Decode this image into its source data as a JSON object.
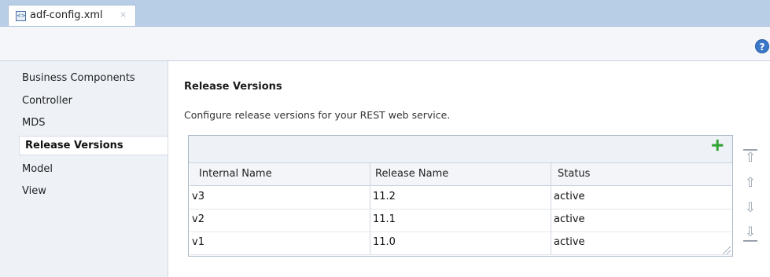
{
  "editor_tab": {
    "label": "adf-config.xml",
    "icon": "xml-file-icon",
    "close": "×"
  },
  "toolbar": {
    "help_icon": "help-icon",
    "help_glyph": "?"
  },
  "sidebar": {
    "items": [
      {
        "label": "Business Components"
      },
      {
        "label": "Controller"
      },
      {
        "label": "MDS"
      },
      {
        "label": "Release Versions",
        "selected": true
      },
      {
        "label": "Model"
      },
      {
        "label": "View"
      }
    ]
  },
  "main": {
    "title": "Release Versions",
    "description": "Configure release versions for your REST web service.",
    "add_icon": "plus-icon",
    "add_glyph": "+",
    "table": {
      "columns": [
        "Internal Name",
        "Release Name",
        "Status"
      ],
      "rows": [
        [
          "v3",
          "11.2",
          "active"
        ],
        [
          "v2",
          "11.1",
          "active"
        ],
        [
          "v1",
          "11.0",
          "active"
        ]
      ]
    },
    "reorder_buttons": [
      {
        "icon": "move-to-top-icon",
        "glyph": "⇧"
      },
      {
        "icon": "move-up-icon",
        "glyph": "⇧"
      },
      {
        "icon": "move-down-icon",
        "glyph": "⇩"
      },
      {
        "icon": "move-to-bottom-icon",
        "glyph": "⇩"
      }
    ]
  },
  "colors": {
    "tab_strip": "#b8cde6",
    "nav_bg": "#eef2f7",
    "add_green": "#2fa32f",
    "help_blue": "#3b78c9"
  }
}
